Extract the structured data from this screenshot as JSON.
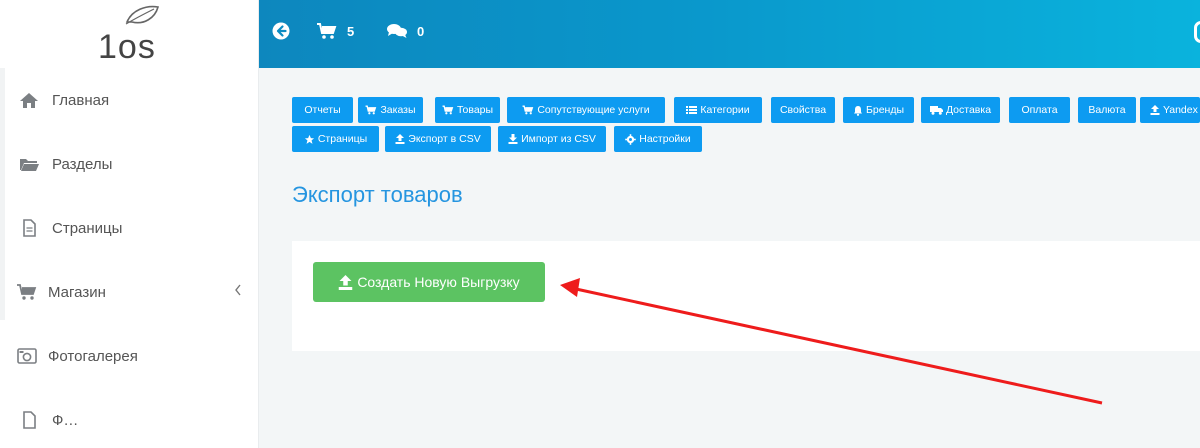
{
  "logo": {
    "text": "1os"
  },
  "sidebar": {
    "items": [
      {
        "label": "Главная",
        "icon": "home-icon"
      },
      {
        "label": "Разделы",
        "icon": "folder-icon"
      },
      {
        "label": "Страницы",
        "icon": "file-icon"
      },
      {
        "label": "Магазин",
        "icon": "cart-icon",
        "chevron": "chevron-left-icon"
      },
      {
        "label": "Фотогалерея",
        "icon": "camera-icon"
      },
      {
        "label": "Ф…",
        "icon": "file-icon"
      }
    ]
  },
  "header": {
    "back_icon": "back-circle-icon",
    "cart_count": "5",
    "comments_count": "0"
  },
  "toolbar": {
    "buttons": [
      {
        "label": "Отчеты",
        "icon": ""
      },
      {
        "label": "Заказы",
        "icon": "cart-icon"
      },
      {
        "label": "Товары",
        "icon": "cart-icon"
      },
      {
        "label": "Сопутствующие услуги",
        "icon": "cart-icon"
      },
      {
        "label": "Категории",
        "icon": "list-icon"
      },
      {
        "label": "Свойства",
        "icon": ""
      },
      {
        "label": "Бренды",
        "icon": "bell-icon"
      },
      {
        "label": "Доставка",
        "icon": "truck-icon"
      },
      {
        "label": "Оплата",
        "icon": ""
      },
      {
        "label": "Валюта",
        "icon": ""
      },
      {
        "label": "Yandex",
        "icon": "upload-icon"
      },
      {
        "label": "Страницы",
        "icon": "star-icon"
      },
      {
        "label": "Экспорт в CSV",
        "icon": "upload-icon"
      },
      {
        "label": "Импорт из CSV",
        "icon": "download-icon"
      },
      {
        "label": "Настройки",
        "icon": "gear-icon"
      }
    ]
  },
  "page": {
    "title": "Экспорт товаров"
  },
  "card": {
    "create_button": "Создать Новую Выгрузку"
  },
  "colors": {
    "primary": "#0d9bf1",
    "success": "#5cc362",
    "title": "#2595e0",
    "annotation": "#ee1c1c"
  }
}
